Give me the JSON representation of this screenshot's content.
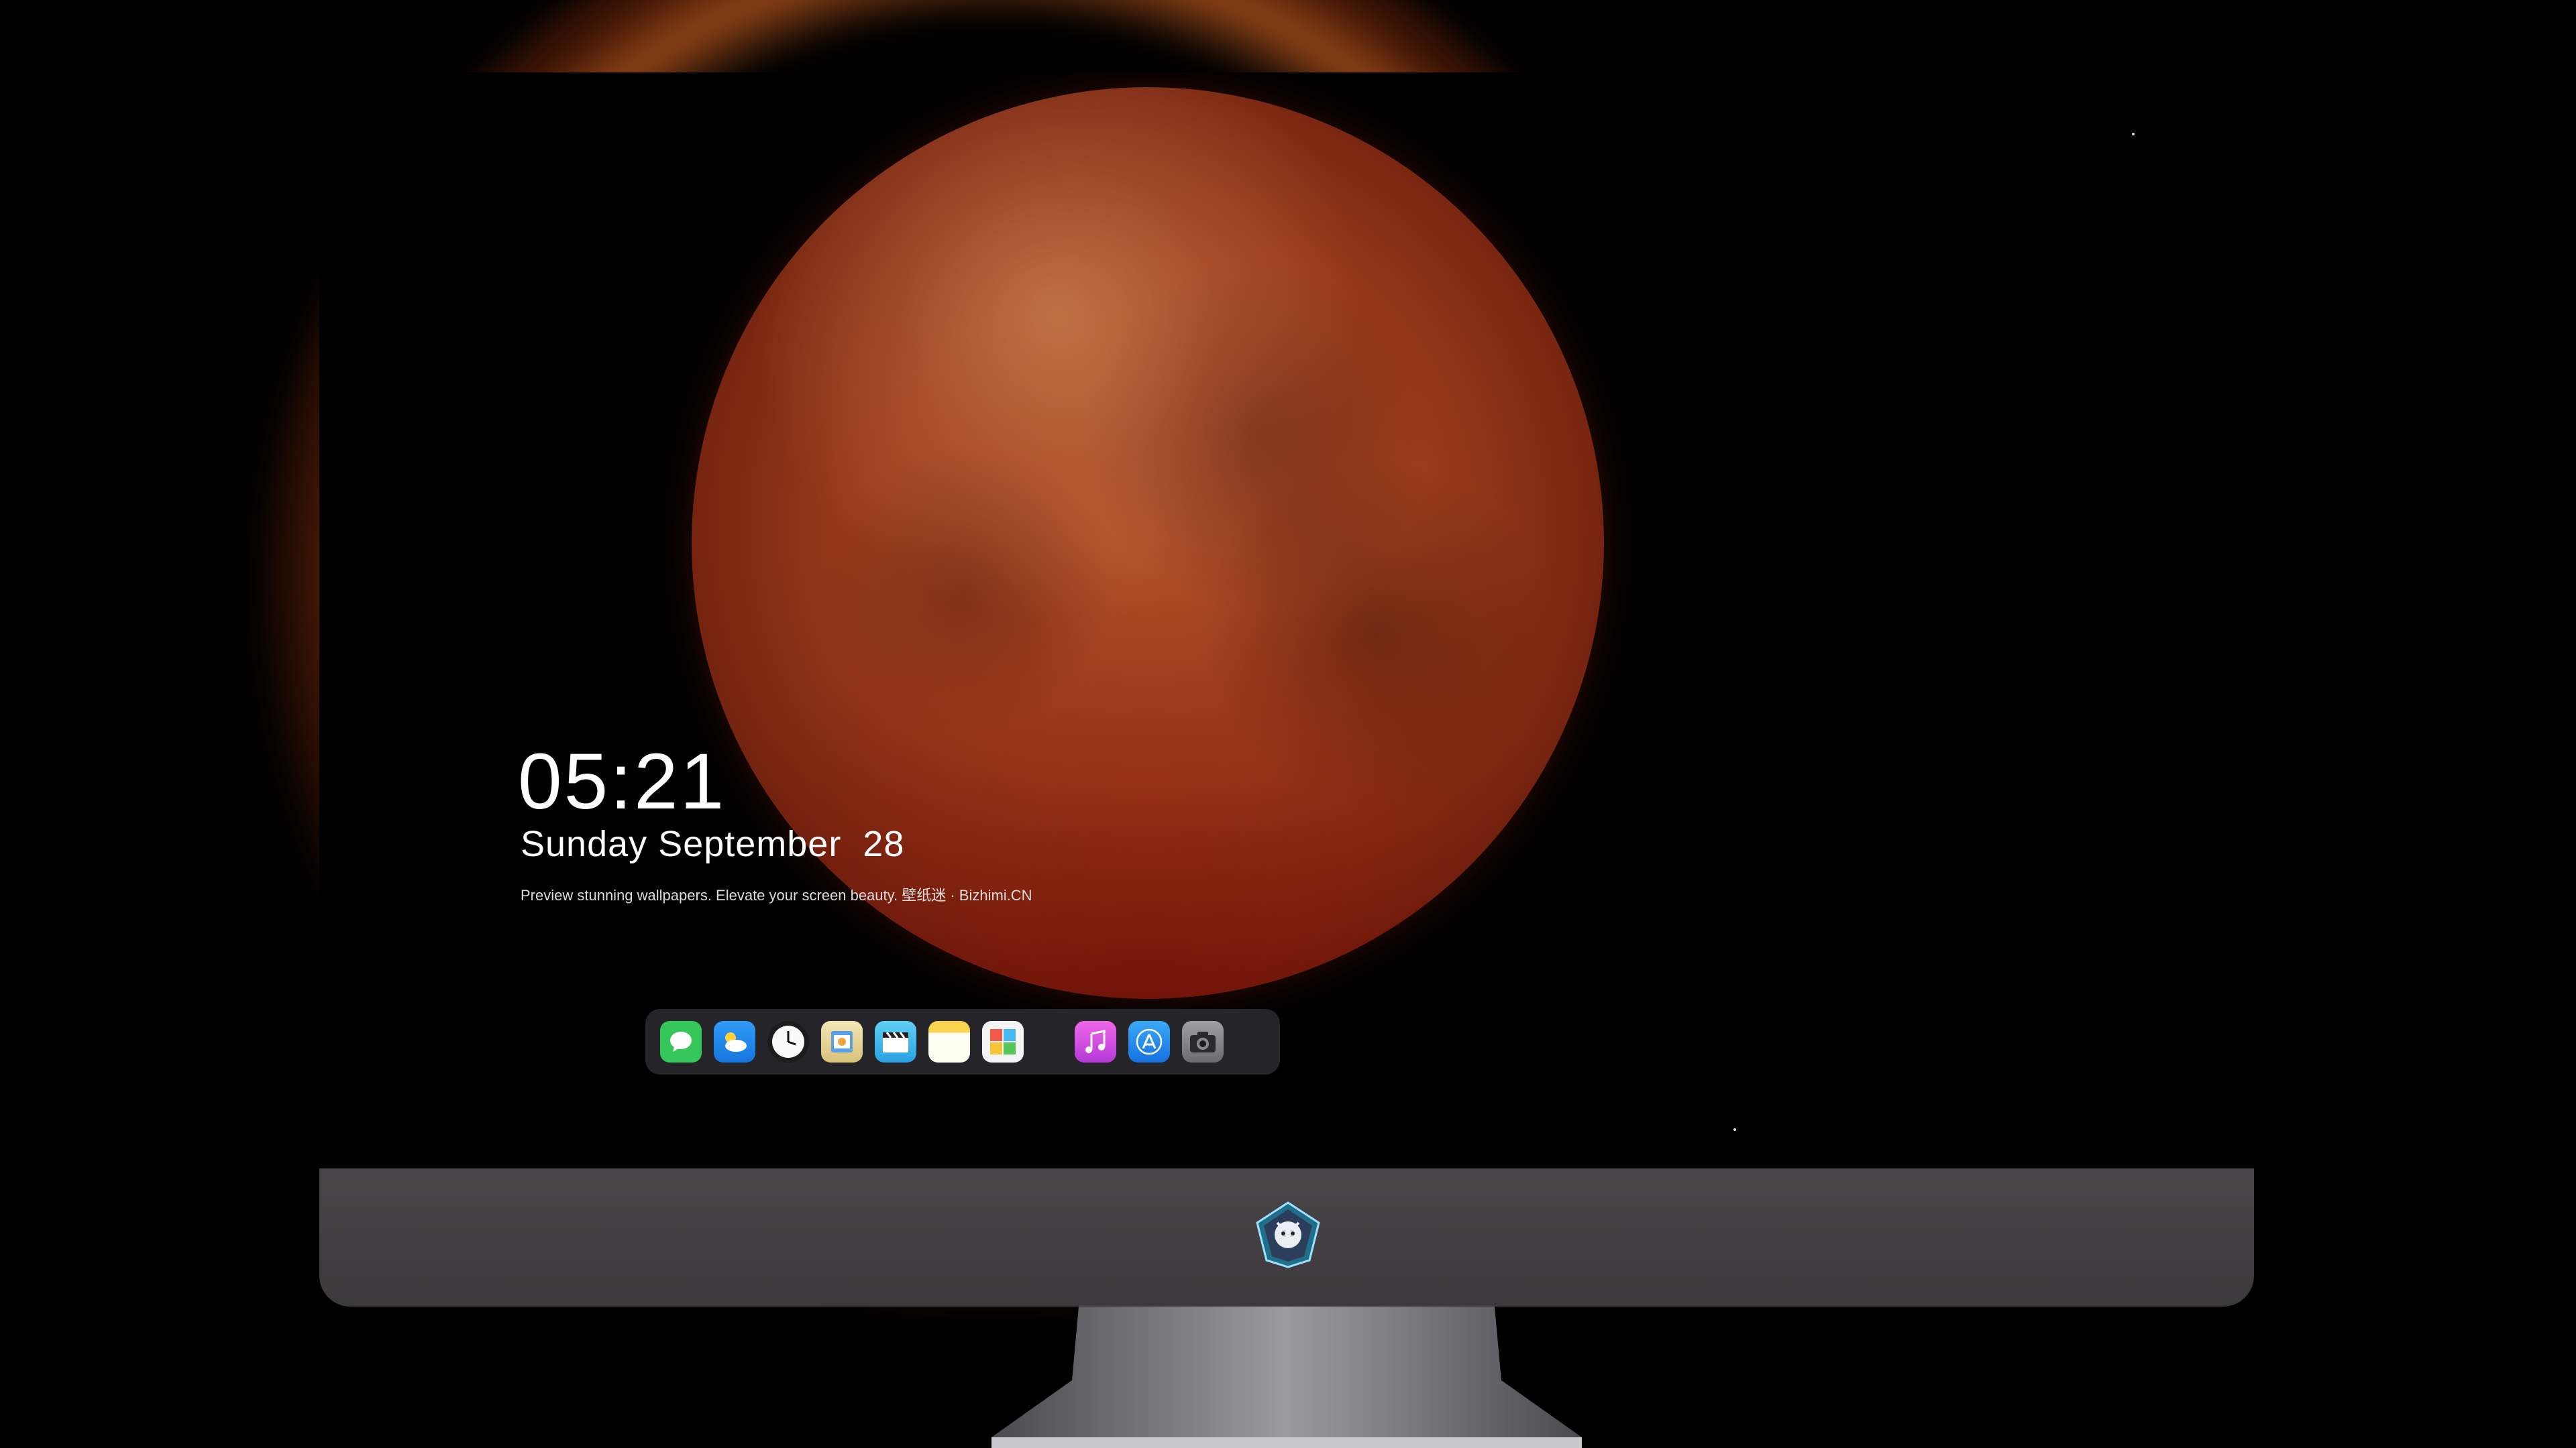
{
  "lockscreen": {
    "time": "05:21",
    "date": "Sunday September  28",
    "tagline": "Preview stunning wallpapers. Elevate your screen beauty. 壁纸迷 · Bizhimi.CN"
  },
  "dock": {
    "apps": [
      {
        "name": "messages-icon",
        "color": "#35c759"
      },
      {
        "name": "weather-icon",
        "color": "#1e8cf0"
      },
      {
        "name": "clock-icon",
        "color": "#2a2a2a"
      },
      {
        "name": "preview-icon",
        "color": "#e8d9a0"
      },
      {
        "name": "clips-icon",
        "color": "#4fb9e8"
      },
      {
        "name": "notes-icon",
        "color": "#f6d34a"
      },
      {
        "name": "photos-icon",
        "color": "#f0f0f0"
      },
      {
        "name": "music-icon",
        "color": "#d04cd6"
      },
      {
        "name": "app-store-icon",
        "color": "#1e8cf0"
      },
      {
        "name": "camera-icon",
        "color": "#8a8a8e"
      }
    ]
  },
  "monitor": {
    "chin_logo": "mascot-logo-icon"
  }
}
